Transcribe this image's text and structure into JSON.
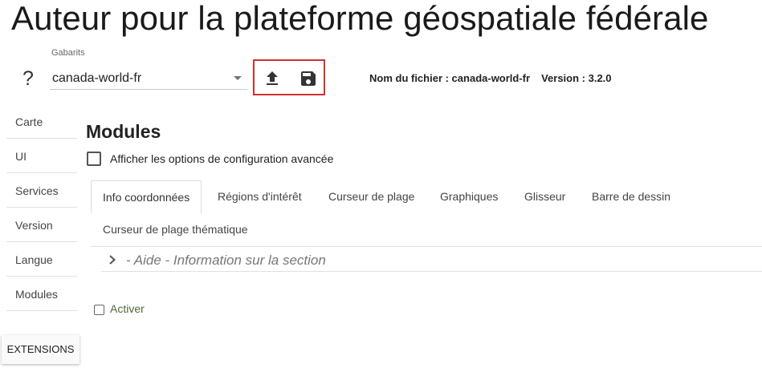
{
  "header": {
    "title": "Auteur pour la plateforme géospatiale fédérale"
  },
  "help": {
    "icon": "question-mark-icon",
    "glyph": "?"
  },
  "templates": {
    "label": "Gabarits",
    "selected": "canada-world-fr"
  },
  "actions": {
    "upload_icon": "upload-icon",
    "save_icon": "save-icon",
    "highlight_color": "#d32f2f"
  },
  "file_info": {
    "filename": "Nom du fichier : canada-world-fr",
    "version": "Version : 3.2.0"
  },
  "sidebar": {
    "items": [
      {
        "label": "Carte"
      },
      {
        "label": "UI"
      },
      {
        "label": "Services"
      },
      {
        "label": "Version"
      },
      {
        "label": "Langue"
      },
      {
        "label": "Modules"
      }
    ],
    "extensions_label": "EXTENSIONS"
  },
  "modules": {
    "title": "Modules",
    "advanced_label": "Afficher les options de configuration avancée",
    "advanced_checked": false,
    "tabs": [
      {
        "label": "Info coordonnées",
        "active": true
      },
      {
        "label": "Régions d'intérêt"
      },
      {
        "label": "Curseur de plage"
      },
      {
        "label": "Graphiques"
      },
      {
        "label": "Glisseur"
      },
      {
        "label": "Barre de dessin"
      },
      {
        "label": "Curseur de plage thématique"
      }
    ],
    "help_section": "- Aide - Information sur la section",
    "activate_label": "Activer",
    "activate_checked": false
  }
}
